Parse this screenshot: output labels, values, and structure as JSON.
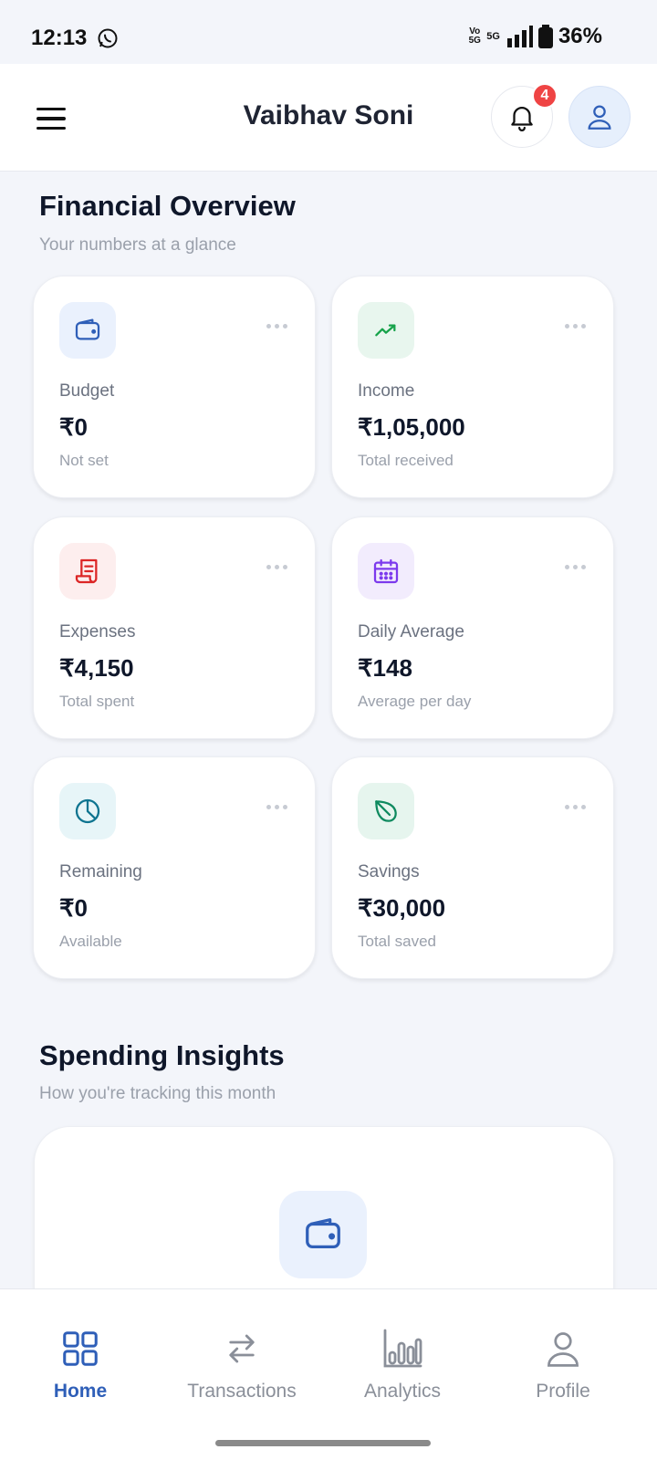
{
  "status_bar": {
    "time": "12:13",
    "volte": "Vo",
    "volte_sub": "5G",
    "network": "5G",
    "battery": "36%"
  },
  "header": {
    "title": "Vaibhav Soni",
    "notification_count": "4"
  },
  "overview": {
    "title": "Financial Overview",
    "subtitle": "Your numbers at a glance",
    "cards": [
      {
        "label": "Budget",
        "value": "₹0",
        "note": "Not set",
        "icon": "wallet-icon",
        "color": "#2f5fb8",
        "bg": "#eaf1fd"
      },
      {
        "label": "Income",
        "value": "₹1,05,000",
        "note": "Total received",
        "icon": "trending-up-icon",
        "color": "#16a34a",
        "bg": "#e8f6ee"
      },
      {
        "label": "Expenses",
        "value": "₹4,150",
        "note": "Total spent",
        "icon": "receipt-icon",
        "color": "#dc2626",
        "bg": "#fdeeee"
      },
      {
        "label": "Daily Average",
        "value": "₹148",
        "note": "Average per day",
        "icon": "calendar-icon",
        "color": "#7c3aed",
        "bg": "#f2ecfd"
      },
      {
        "label": "Remaining",
        "value": "₹0",
        "note": "Available",
        "icon": "pie-chart-icon",
        "color": "#0e7490",
        "bg": "#e7f5f8"
      },
      {
        "label": "Savings",
        "value": "₹30,000",
        "note": "Total saved",
        "icon": "leaf-icon",
        "color": "#0f8a5f",
        "bg": "#e6f5ee"
      }
    ]
  },
  "insights": {
    "title": "Spending Insights",
    "subtitle": "How you're tracking this month"
  },
  "bottom_nav": [
    {
      "label": "Home",
      "icon": "home-grid-icon",
      "active": true
    },
    {
      "label": "Transactions",
      "icon": "swap-arrows-icon",
      "active": false
    },
    {
      "label": "Analytics",
      "icon": "bar-chart-icon",
      "active": false
    },
    {
      "label": "Profile",
      "icon": "person-icon",
      "active": false
    }
  ],
  "colors": {
    "accent": "#2f5fb8",
    "badge": "#ef4444",
    "background": "#f3f5fa"
  }
}
